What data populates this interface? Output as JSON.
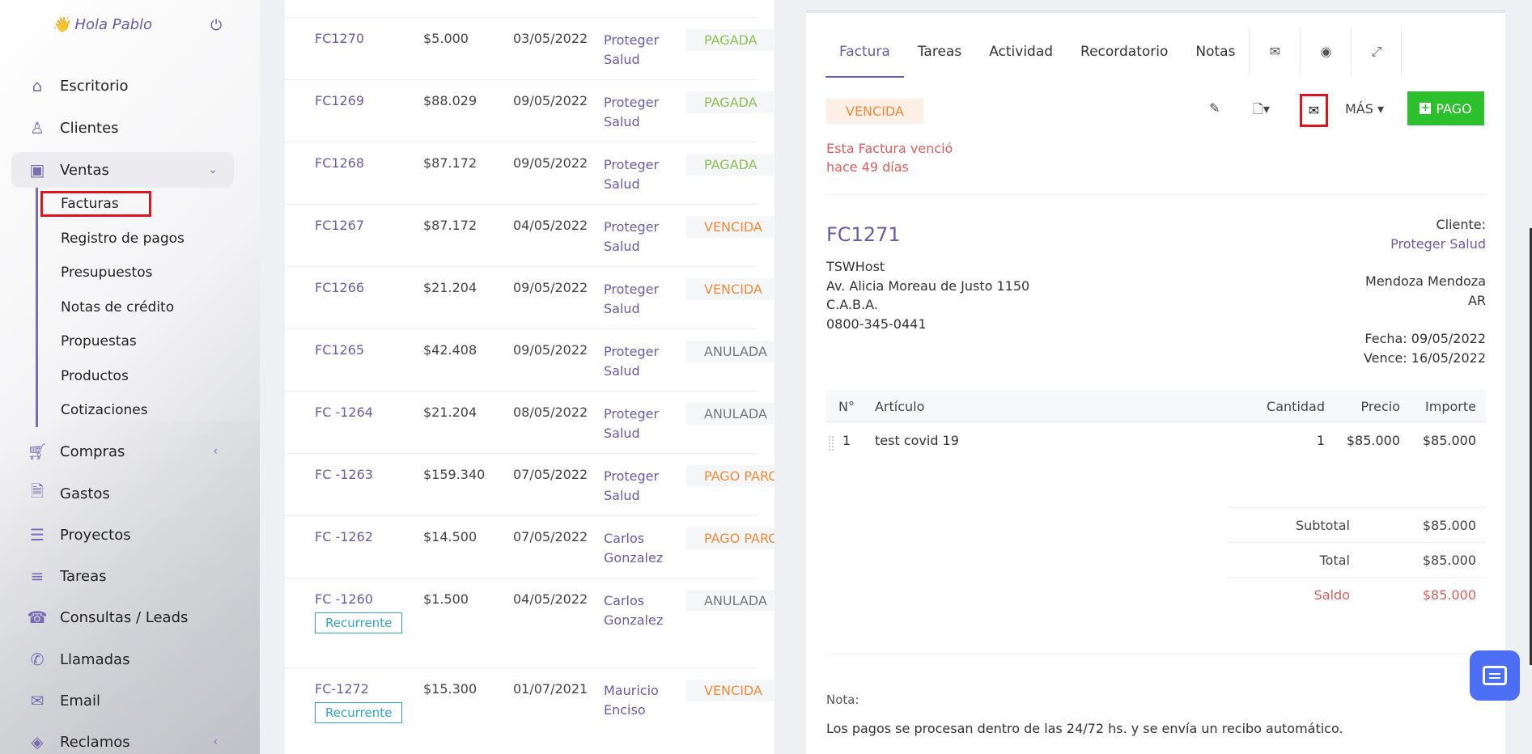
{
  "sidebar": {
    "greeting": "Hola Pablo",
    "items": [
      {
        "label": "Escritorio",
        "icon": "home-icon"
      },
      {
        "label": "Clientes",
        "icon": "user-icon"
      },
      {
        "label": "Ventas",
        "icon": "money-icon"
      },
      {
        "label": "Compras",
        "icon": "cart-icon"
      },
      {
        "label": "Gastos",
        "icon": "file-icon"
      },
      {
        "label": "Proyectos",
        "icon": "bars-icon"
      },
      {
        "label": "Tareas",
        "icon": "tasks-icon"
      },
      {
        "label": "Consultas / Leads",
        "icon": "phone-desk-icon"
      },
      {
        "label": "Llamadas",
        "icon": "phone-volume-icon"
      },
      {
        "label": "Email",
        "icon": "envelope-icon"
      },
      {
        "label": "Reclamos",
        "icon": "tag-icon"
      }
    ],
    "ventas_sub": [
      "Facturas",
      "Registro de pagos",
      "Presupuestos",
      "Notas de crédito",
      "Propuestas",
      "Productos",
      "Cotizaciones"
    ]
  },
  "list": {
    "rows": [
      {
        "num": "FC1270",
        "amount": "$5.000",
        "date": "03/05/2022",
        "client1": "Proteger",
        "client2": "Salud",
        "status": "PAGADA",
        "status_type": "paid"
      },
      {
        "num": "FC1269",
        "amount": "$88.029",
        "date": "09/05/2022",
        "client1": "Proteger",
        "client2": "Salud",
        "status": "PAGADA",
        "status_type": "paid"
      },
      {
        "num": "FC1268",
        "amount": "$87.172",
        "date": "09/05/2022",
        "client1": "Proteger",
        "client2": "Salud",
        "status": "PAGADA",
        "status_type": "paid"
      },
      {
        "num": "FC1267",
        "amount": "$87.172",
        "date": "04/05/2022",
        "client1": "Proteger",
        "client2": "Salud",
        "status": "VENCIDA",
        "status_type": "over"
      },
      {
        "num": "FC1266",
        "amount": "$21.204",
        "date": "09/05/2022",
        "client1": "Proteger",
        "client2": "Salud",
        "status": "VENCIDA",
        "status_type": "over"
      },
      {
        "num": "FC1265",
        "amount": "$42.408",
        "date": "09/05/2022",
        "client1": "Proteger",
        "client2": "Salud",
        "status": "ANULADA",
        "status_type": "void"
      },
      {
        "num": "FC -1264",
        "amount": "$21.204",
        "date": "08/05/2022",
        "client1": "Proteger",
        "client2": "Salud",
        "status": "ANULADA",
        "status_type": "void"
      },
      {
        "num": "FC -1263",
        "amount": "$159.340",
        "date": "07/05/2022",
        "client1": "Proteger",
        "client2": "Salud",
        "status": "PAGO PARCIAL",
        "status_type": "part"
      },
      {
        "num": "FC -1262",
        "amount": "$14.500",
        "date": "07/05/2022",
        "client1": "Carlos",
        "client2": "Gonzalez",
        "status": "PAGO PARCIAL",
        "status_type": "part"
      },
      {
        "num": "FC -1260",
        "amount": "$1.500",
        "date": "04/05/2022",
        "client1": "Carlos",
        "client2": "Gonzalez",
        "status": "ANULADA",
        "status_type": "void",
        "badge": "Recurrente"
      },
      {
        "num": "FC-1272",
        "amount": "$15.300",
        "date": "01/07/2021",
        "client1": "Mauricio",
        "client2": "Enciso",
        "status": "VENCIDA",
        "status_type": "over",
        "badge": "Recurrente"
      }
    ]
  },
  "detail": {
    "tabs": [
      "Factura",
      "Tareas",
      "Actividad",
      "Recordatorio",
      "Notas"
    ],
    "status": "VENCIDA",
    "overdue_msg": "Esta Factura venció hace 49 días",
    "more_label": "MÁS",
    "pay_label": "PAGO",
    "invoice_number": "FC1271",
    "company": {
      "name": "TSWHost",
      "address": "Av. Alicia Moreau de Justo 1150",
      "city": "C.A.B.A.",
      "phone": "0800-345-0441"
    },
    "client_label": "Cliente:",
    "client_name": "Proteger Salud",
    "client_city": "Mendoza Mendoza",
    "client_country": "AR",
    "fecha": "Fecha: 09/05/2022",
    "vence": "Vence: 16/05/2022",
    "table_headers": {
      "num": "N°",
      "item": "Artículo",
      "qty": "Cantidad",
      "price": "Precio",
      "amount": "Importe"
    },
    "items": [
      {
        "num": "1",
        "item": "test covid 19",
        "qty": "1",
        "price": "$85.000",
        "amount": "$85.000"
      }
    ],
    "subtotal_label": "Subtotal",
    "subtotal": "$85.000",
    "total_label": "Total",
    "total": "$85.000",
    "saldo_label": "Saldo",
    "saldo": "$85.000",
    "nota_label": "Nota:",
    "nota_text": "Los pagos se procesan dentro de las 24/72 hs. y se envía un recibo automático."
  },
  "colors": {
    "accent": "#6a5aa8",
    "pay_button": "#2cc02c",
    "overdue": "#f08a3a",
    "paid": "#8cc152",
    "highlight": "#e0141e"
  }
}
